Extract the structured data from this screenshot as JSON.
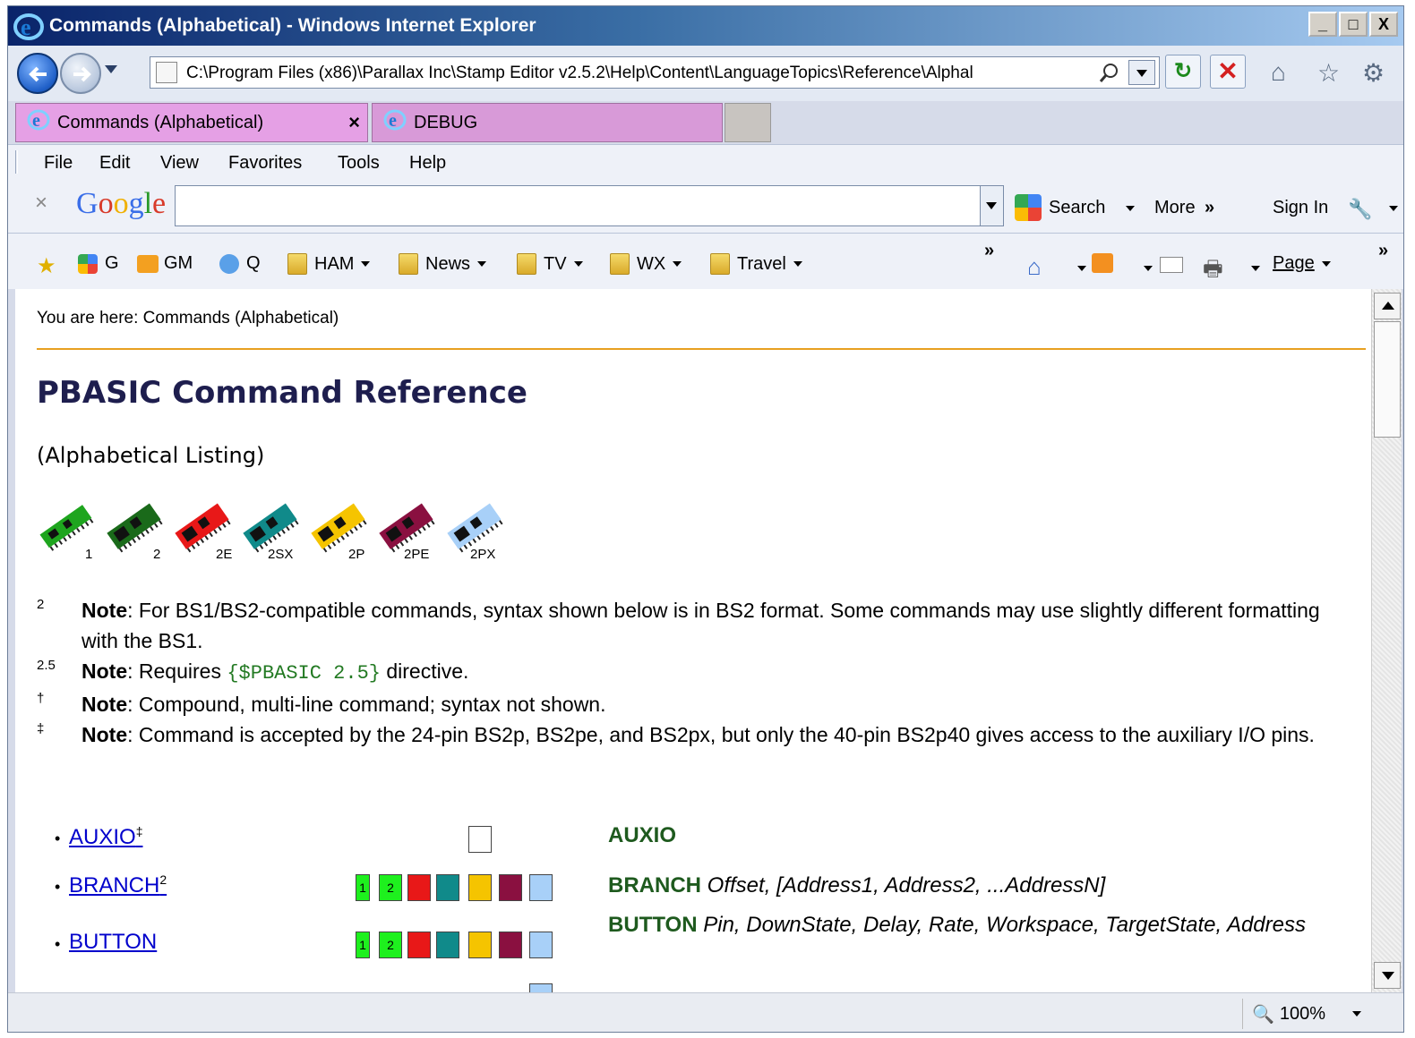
{
  "window": {
    "title": "Commands (Alphabetical) - Windows Internet Explorer",
    "buttons": [
      "_",
      "□",
      "X"
    ]
  },
  "address": {
    "url": "C:\\Program Files (x86)\\Parallax Inc\\Stamp Editor v2.5.2\\Help\\Content\\LanguageTopics\\Reference\\Alphal"
  },
  "tabs": [
    {
      "label": "Commands (Alphabetical)",
      "close": "×"
    },
    {
      "label": "DEBUG"
    }
  ],
  "menu": [
    "File",
    "Edit",
    "View",
    "Favorites",
    "Tools",
    "Help"
  ],
  "google_toolbar": {
    "close": "×",
    "logo": "Google",
    "search_label": "Search",
    "more_label": "More",
    "sign_in_label": "Sign In"
  },
  "favorites": [
    {
      "label": "G",
      "icon": "google-icon"
    },
    {
      "label": "GM",
      "icon": "gmail-icon"
    },
    {
      "label": "Q",
      "icon": "globe-icon"
    },
    {
      "label": "HAM",
      "icon": "folder-icon"
    },
    {
      "label": "News",
      "icon": "folder-icon"
    },
    {
      "label": "TV",
      "icon": "folder-icon"
    },
    {
      "label": "WX",
      "icon": "folder-icon"
    },
    {
      "label": "Travel",
      "icon": "folder-icon"
    }
  ],
  "command_bar": {
    "page_label": "Page"
  },
  "content": {
    "breadcrumb": "You are here: Commands (Alphabetical)",
    "title": "PBASIC Command Reference",
    "subtitle": "(Alphabetical Listing)",
    "chips": [
      {
        "label": "1",
        "color": "#1ea51e"
      },
      {
        "label": "2",
        "color": "#1a6a1a"
      },
      {
        "label": "2E",
        "color": "#e81818"
      },
      {
        "label": "2SX",
        "color": "#108a8a"
      },
      {
        "label": "2P",
        "color": "#f5c400"
      },
      {
        "label": "2PE",
        "color": "#8a1040"
      },
      {
        "label": "2PX",
        "color": "#a8d0f8"
      }
    ],
    "notes": [
      {
        "symbol": "2",
        "lead": "Note",
        "text": ": For BS1/BS2-compatible commands, syntax shown below is in BS2 format. Some commands may use slightly different formatting with the BS1."
      },
      {
        "symbol": "2.5",
        "lead": "Note",
        "text_before": ": Requires ",
        "code": "{$PBASIC 2.5}",
        "text_after": " directive."
      },
      {
        "symbol": "†",
        "lead": "Note",
        "text": ": Compound, multi-line command; syntax not shown."
      },
      {
        "symbol": "‡",
        "lead": "Note",
        "text": ": Command is accepted by the 24-pin BS2p, BS2pe, and BS2px, but only the 40-pin BS2p40 gives access to the auxiliary I/O pins."
      }
    ],
    "commands": [
      {
        "name": "AUXIO",
        "sup": "‡",
        "syntax_bold": "AUXIO",
        "syntax_italic": ""
      },
      {
        "name": "BRANCH",
        "sup": "2",
        "syntax_bold": "BRANCH",
        "syntax_italic": "Offset, [Address1, Address2, ...AddressN]"
      },
      {
        "name": "BUTTON",
        "sup": "",
        "syntax_bold": "BUTTON",
        "syntax_italic": "Pin, DownState, Delay, Rate, Workspace, TargetState, Address"
      }
    ]
  },
  "status": {
    "zoom": "100%"
  }
}
